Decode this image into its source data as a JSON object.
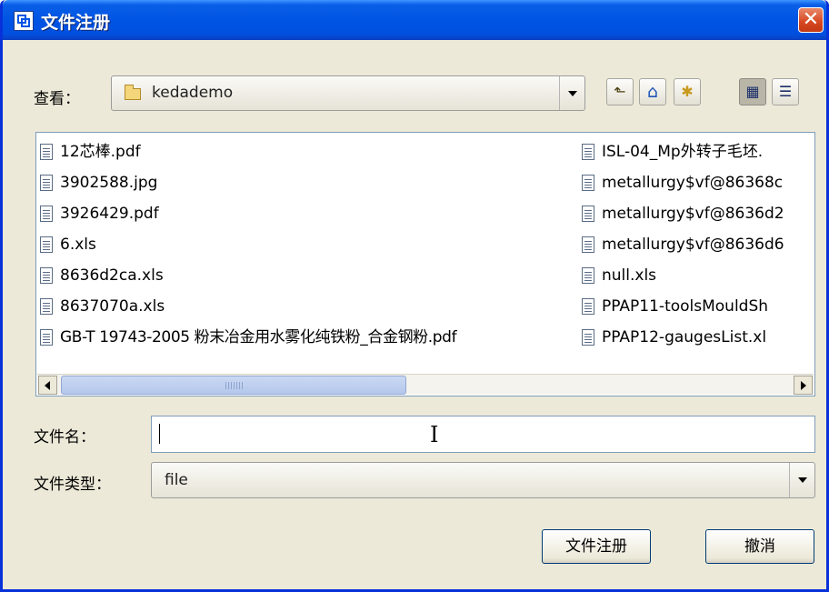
{
  "window": {
    "title": "文件注册",
    "close_glyph": "✕"
  },
  "lookin": {
    "label": "查看：",
    "value": "kedademo"
  },
  "toolbar": {
    "up_icon": "up-folder-icon",
    "home_icon": "home-icon",
    "newfolder_icon": "new-folder-icon",
    "list_icon": "list-view-icon",
    "details_icon": "details-view-icon",
    "up_glyph": "⬑",
    "home_glyph": "⌂",
    "newfolder_glyph": "✱",
    "list_glyph": "▦",
    "details_glyph": "☰"
  },
  "files": {
    "col1": [
      "12芯棒.pdf",
      "3902588.jpg",
      "3926429.pdf",
      "6.xls",
      "8636d2ca.xls",
      "8637070a.xls",
      "GB-T 19743-2005 粉末冶金用水雾化纯铁粉_合金钢粉.pdf"
    ],
    "col2": [
      "ISL-04_Mp外转子毛坯.",
      "metallurgy$vf@86368c",
      "metallurgy$vf@8636d2",
      "metallurgy$vf@8636d6",
      "null.xls",
      "PPAP11-toolsMouldSh",
      "PPAP12-gaugesList.xl"
    ]
  },
  "filename": {
    "label": "文件名：",
    "value": ""
  },
  "filetype": {
    "label": "文件类型：",
    "value": "file"
  },
  "buttons": {
    "register": "文件注册",
    "cancel": "撤消"
  },
  "colors": {
    "titlebar": "#0054e3",
    "dialog_bg": "#ece9d8",
    "close_btn": "#d6461f"
  }
}
